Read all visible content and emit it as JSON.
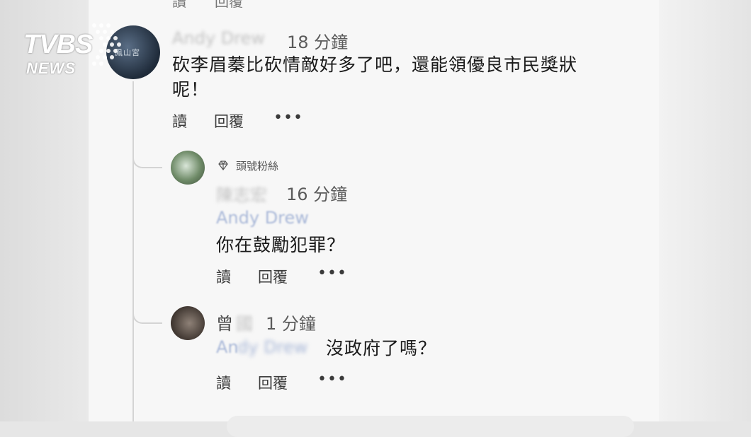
{
  "logo": {
    "main": "TVBS",
    "sub": "NEWS"
  },
  "top_cut": {
    "read": "讀",
    "reply": "回覆"
  },
  "comment1": {
    "author": "Andy Drew",
    "time": "18 分鐘",
    "text_line1": "砍李眉蓁比砍情敵好多了吧，還能領優良市民獎狀",
    "text_line2": "呢！",
    "read_label": "讀",
    "reply_label": "回覆",
    "more": "•••",
    "avatar_text": "鳳山宮"
  },
  "reply1": {
    "badge": "頭號粉絲",
    "author": "陳志宏",
    "time": "16 分鐘",
    "mention": "Andy Drew",
    "text": "你在鼓勵犯罪？",
    "read_label": "讀",
    "reply_label": "回覆",
    "more": "•••"
  },
  "reply2": {
    "author_visible": "曾",
    "author_blurred": "國",
    "time": "1 分鐘",
    "mention_visible": "An",
    "mention_blurred": "dy Drew",
    "text": "沒政府了嗎？",
    "read_label": "讀",
    "reply_label": "回覆",
    "more": "•••"
  }
}
